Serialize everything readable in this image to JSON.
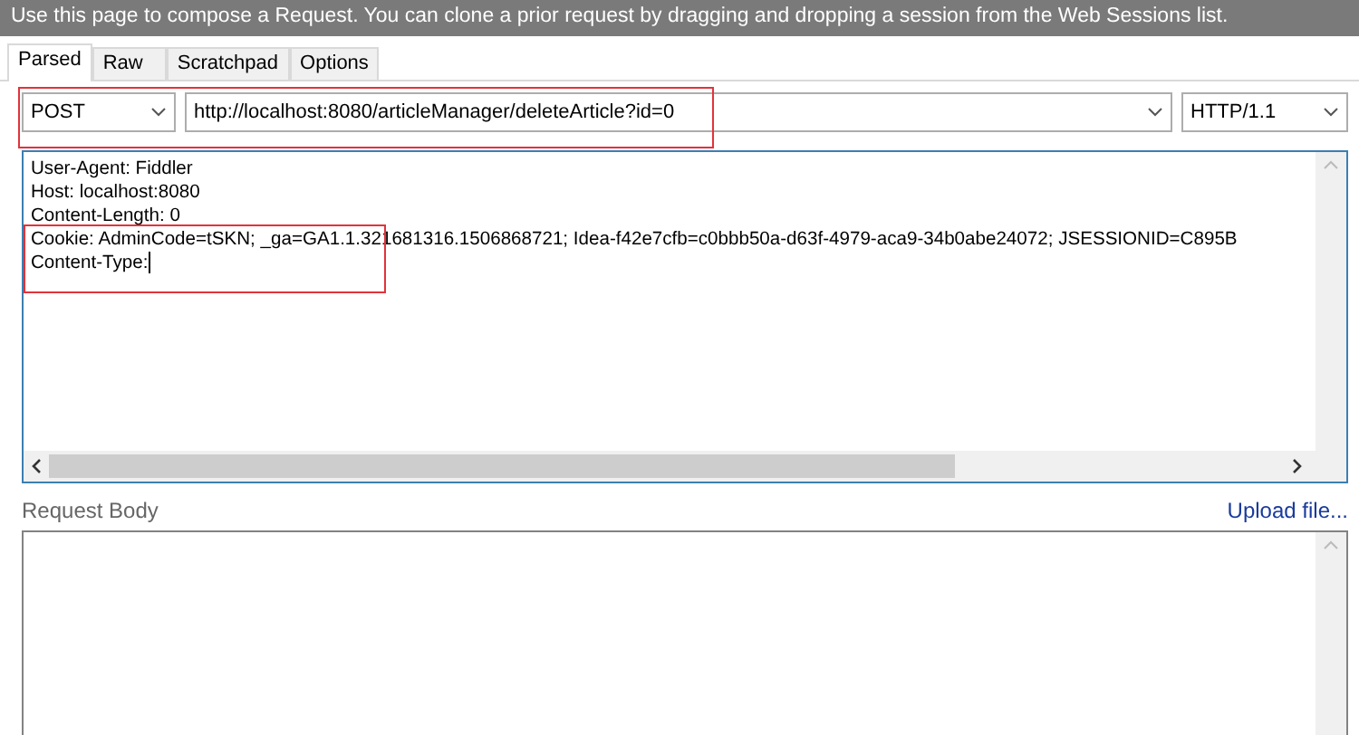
{
  "banner": {
    "text": "Use this page to compose a Request. You can clone a prior request by dragging and dropping a session from the Web Sessions list."
  },
  "tabs": [
    {
      "label": "Parsed",
      "selected": true
    },
    {
      "label": "Raw",
      "selected": false
    },
    {
      "label": "Scratchpad",
      "selected": false
    },
    {
      "label": "Options",
      "selected": false
    }
  ],
  "request_line": {
    "method": "POST",
    "url": "http://localhost:8080/articleManager/deleteArticle?id=0",
    "version": "HTTP/1.1",
    "annotated": true
  },
  "headers": [
    {
      "text": "User-Agent: Fiddler",
      "annotated": false
    },
    {
      "text": "Host: localhost:8080",
      "annotated": false
    },
    {
      "text": "Content-Length: 0",
      "annotated": false
    },
    {
      "text": "Cookie: AdminCode=tSKN; _ga=GA1.1.321681316.1506868721; Idea-f42e7cfb=c0bbb50a-d63f-4979-aca9-34b0abe24072; JSESSIONID=C895B",
      "annotated": true
    },
    {
      "text": "Content-Type:",
      "annotated": true
    }
  ],
  "request_body": {
    "label": "Request Body",
    "link": "Upload file..."
  }
}
